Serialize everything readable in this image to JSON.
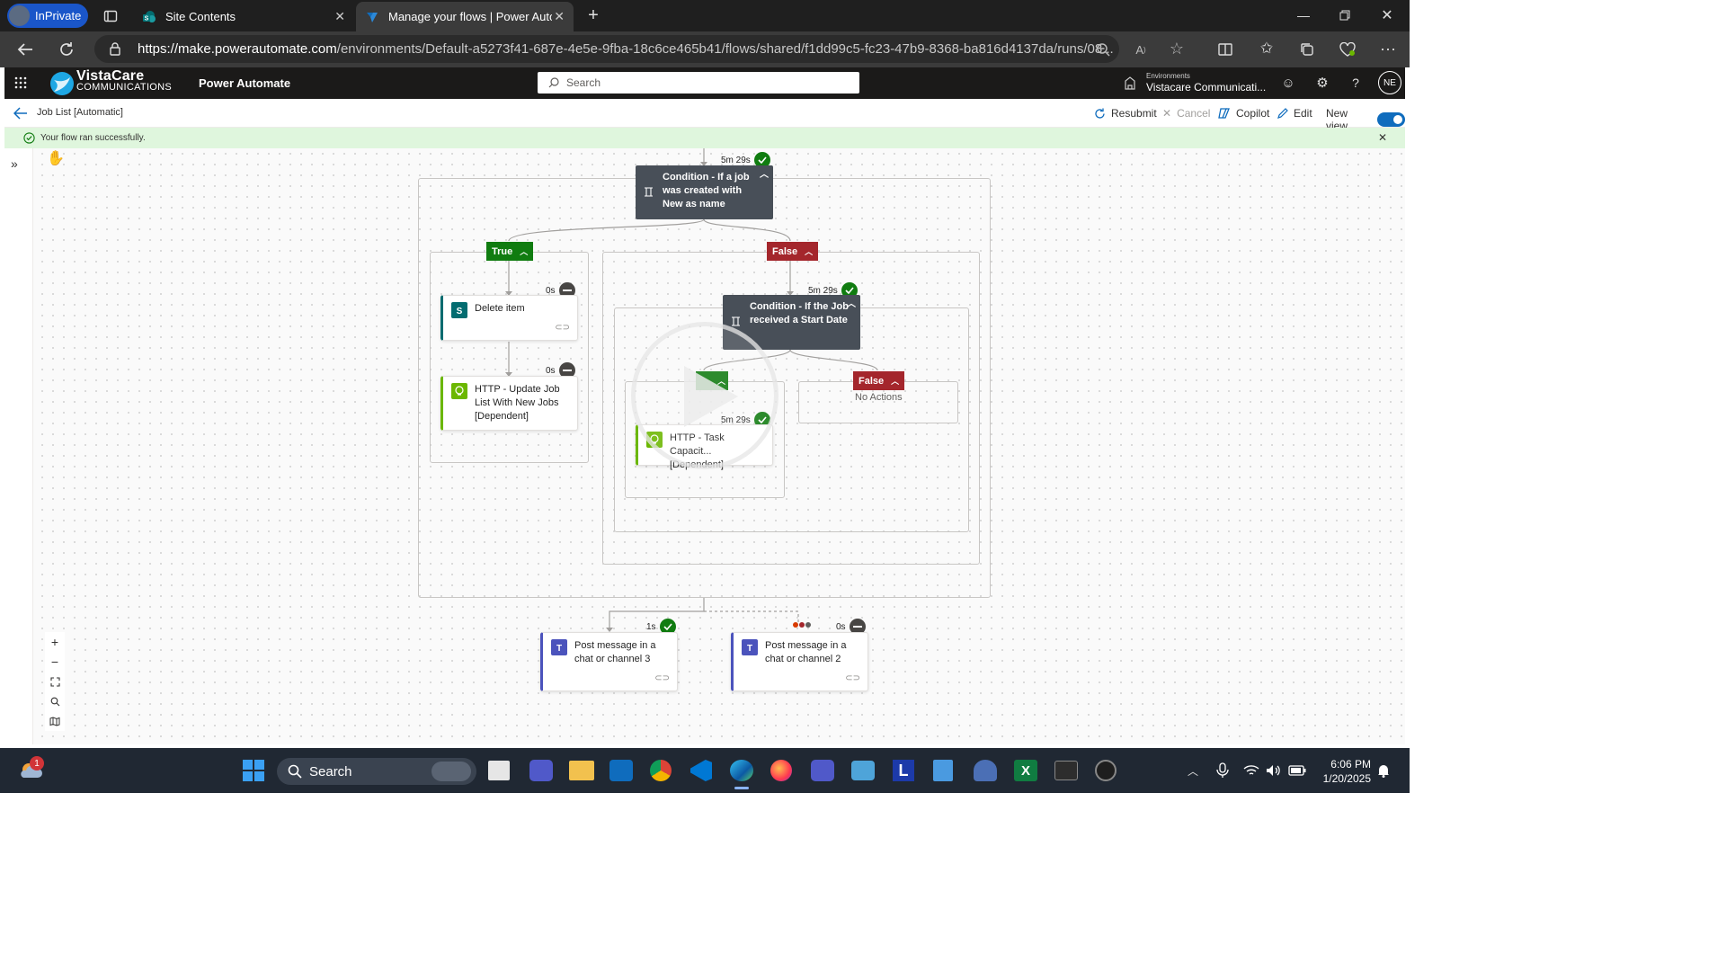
{
  "browser": {
    "inprivate_label": "InPrivate",
    "tabs": [
      {
        "label": "Site Contents",
        "active": false
      },
      {
        "label": "Manage your flows | Power Autom",
        "active": true
      }
    ],
    "url_host": "https://make.powerautomate.com",
    "url_path": "/environments/Default-a5273f41-687e-4e5e-9fba-18c6ce465b41/flows/shared/f1dd99c5-fc23-47b9-8368-ba816d4137da/runs/08..."
  },
  "app_header": {
    "brand_top": "VistaCare",
    "brand_bottom": "COMMUNICATIONS",
    "app_name": "Power Automate",
    "search_placeholder": "Search",
    "env_label": "Environments",
    "env_name": "Vistacare Communicati...",
    "avatar_initials": "NE"
  },
  "command_bar": {
    "flow_title": "Job List [Automatic]",
    "resubmit": "Resubmit",
    "cancel": "Cancel",
    "copilot": "Copilot",
    "edit": "Edit",
    "new_view": "New view",
    "new_view_on": true
  },
  "status": {
    "message": "Your flow ran successfully."
  },
  "flow": {
    "condition1": {
      "title": "Condition - If a job was created with New as name",
      "duration": "5m 29s"
    },
    "true_label": "True",
    "false_label": "False",
    "delete_item": {
      "title": "Delete item",
      "duration": "0s"
    },
    "http_update": {
      "title": "HTTP - Update Job List With New Jobs [Dependent]",
      "duration": "0s"
    },
    "condition2": {
      "title": "Condition - If the Job received a Start Date",
      "duration": "5m 29s"
    },
    "http_task": {
      "title": "HTTP - Task Capacity [Dependent]",
      "title_visible": "HTTP - Task Capacit... [Dependent]",
      "duration": "5m 29s"
    },
    "inner_false_label": "False",
    "no_actions": "No Actions",
    "post3": {
      "title": "Post message in a chat or channel 3",
      "duration": "1s"
    },
    "post2": {
      "title": "Post message in a chat or channel 2",
      "duration": "0s"
    }
  },
  "taskbar": {
    "search_label": "Search",
    "time": "6:06 PM",
    "date": "1/20/2025",
    "weather_badge": "1"
  },
  "colors": {
    "success": "#107c10",
    "false_red": "#a4262c",
    "condition_bg": "#484f58",
    "accent": "#0f6cbd"
  }
}
